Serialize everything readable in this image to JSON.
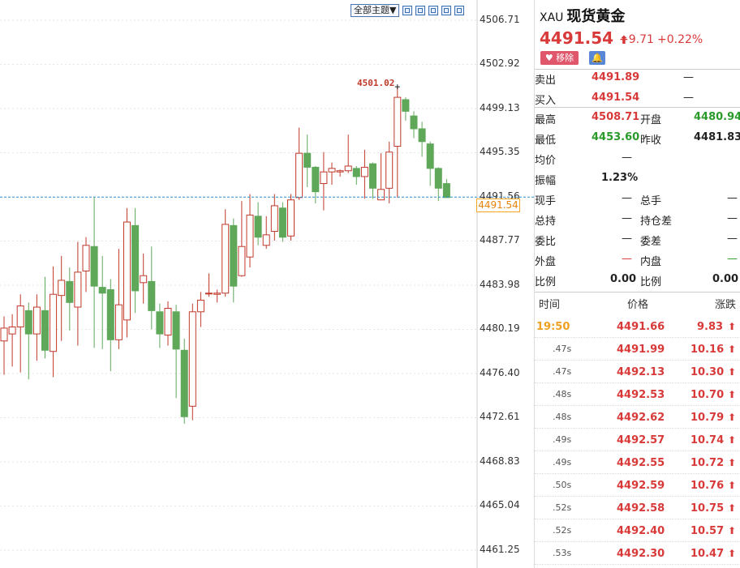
{
  "toolbar": {
    "theme_label": "全部主题▼",
    "icons": [
      "zoom-in-icon",
      "kline-icon",
      "grid-icon",
      "fullscreen-icon",
      "restore-icon"
    ]
  },
  "chart": {
    "max_label": "4501.02",
    "current_price_tag": "4491.54",
    "y_ticks": [
      "4506.71",
      "4502.92",
      "4499.13",
      "4495.35",
      "4491.56",
      "4487.77",
      "4483.98",
      "4480.19",
      "4476.40",
      "4472.61",
      "4468.83",
      "4465.04",
      "4461.25"
    ],
    "colors": {
      "up": "#c0392b",
      "down": "#5fa85a",
      "price_line": "#2f8fd0"
    }
  },
  "chart_data": {
    "type": "candlestick",
    "ylim": [
      4461.25,
      4506.71
    ],
    "current": 4491.54,
    "candles": [
      [
        4479.2,
        4480.3,
        4476.3,
        4481.3
      ],
      [
        4479.8,
        4480.4,
        4477.0,
        4481.5
      ],
      [
        4480.4,
        4482.2,
        4476.5,
        4483.2
      ],
      [
        4481.8,
        4479.8,
        4475.9,
        4482.5
      ],
      [
        4479.8,
        4482.1,
        4477.5,
        4483.2
      ],
      [
        4481.8,
        4478.4,
        4477.7,
        4484.7
      ],
      [
        4478.3,
        4483.2,
        4476.1,
        4485.6
      ],
      [
        4483.1,
        4484.4,
        4479.2,
        4486.5
      ],
      [
        4484.3,
        4482.5,
        4480.1,
        4485.5
      ],
      [
        4482.1,
        4485.1,
        4478.8,
        4487.7
      ],
      [
        4485.2,
        4487.4,
        4483.4,
        4488.1
      ],
      [
        4487.3,
        4483.9,
        4478.6,
        4491.5
      ],
      [
        4483.8,
        4483.3,
        4478.5,
        4486.5
      ],
      [
        4483.6,
        4479.3,
        4476.6,
        4484.5
      ],
      [
        4479.3,
        4482.3,
        4478.5,
        4487.1
      ],
      [
        4481.0,
        4489.4,
        4479.5,
        4490.6
      ],
      [
        4489.1,
        4483.5,
        4481.6,
        4490.6
      ],
      [
        4484.2,
        4484.8,
        4482.4,
        4486.7
      ],
      [
        4484.3,
        4481.8,
        4480.2,
        4487.3
      ],
      [
        4481.7,
        4479.8,
        4478.6,
        4482.4
      ],
      [
        4479.7,
        4482.0,
        4478.8,
        4482.6
      ],
      [
        4481.7,
        4478.5,
        4474.3,
        4482.3
      ],
      [
        4478.4,
        4472.7,
        4472.1,
        4479.4
      ],
      [
        4473.6,
        4481.7,
        4472.4,
        4482.4
      ],
      [
        4481.7,
        4482.7,
        4480.4,
        4483.4
      ],
      [
        4483.3,
        4483.3,
        4483.0,
        4485.0
      ],
      [
        4483.2,
        4483.3,
        4482.5,
        4483.6
      ],
      [
        4483.3,
        4489.2,
        4483.0,
        4490.5
      ],
      [
        4489.1,
        4483.9,
        4482.5,
        4489.7
      ],
      [
        4484.8,
        4487.3,
        4484.7,
        4491.2
      ],
      [
        4486.4,
        4490.0,
        4485.5,
        4491.8
      ],
      [
        4489.9,
        4488.1,
        4487.4,
        4491.1
      ],
      [
        4487.4,
        4488.3,
        4487.1,
        4489.9
      ],
      [
        4488.6,
        4490.8,
        4487.8,
        4491.8
      ],
      [
        4490.6,
        4488.1,
        4487.7,
        4491.1
      ],
      [
        4488.2,
        4491.3,
        4487.8,
        4491.8
      ],
      [
        4491.5,
        4495.3,
        4491.3,
        4497.5
      ],
      [
        4495.3,
        4494.1,
        4492.4,
        4496.9
      ],
      [
        4494.1,
        4492.0,
        4491.0,
        4494.2
      ],
      [
        4492.7,
        4493.7,
        4490.4,
        4495.4
      ],
      [
        4493.7,
        4494.0,
        4492.6,
        4494.5
      ],
      [
        4493.7,
        4493.8,
        4493.3,
        4493.9
      ],
      [
        4493.8,
        4494.2,
        4493.6,
        4496.9
      ],
      [
        4494.0,
        4493.3,
        4492.6,
        4494.2
      ],
      [
        4493.3,
        4494.1,
        4491.4,
        4495.6
      ],
      [
        4494.4,
        4492.3,
        4491.4,
        4494.5
      ],
      [
        4491.3,
        4492.2,
        4491.3,
        4495.3
      ],
      [
        4492.3,
        4495.4,
        4491.0,
        4496.3
      ],
      [
        4495.9,
        4500.1,
        4491.5,
        4501.0
      ],
      [
        4499.9,
        4498.9,
        4498.1,
        4500.1
      ],
      [
        4498.5,
        4497.4,
        4496.6,
        4498.9
      ],
      [
        4497.4,
        4496.3,
        4495.0,
        4498.0
      ],
      [
        4496.1,
        4494.0,
        4492.5,
        4496.3
      ],
      [
        4494.0,
        4492.3,
        4491.2,
        4494.1
      ],
      [
        4492.7,
        4491.5,
        4491.5,
        4493.1
      ]
    ]
  },
  "panel": {
    "code": "XAU",
    "name": "现货黄金",
    "price": "4491.54",
    "change": "+9.71",
    "change_pct": "+0.22%",
    "remove_label": "移除",
    "sell_label": "卖出",
    "sell_value": "4491.89",
    "sell_extra": "—",
    "buy_label": "买入",
    "buy_value": "4491.54",
    "buy_extra": "—",
    "high_label": "最高",
    "high_value": "4508.71",
    "open_label": "开盘",
    "open_value": "4480.94",
    "low_label": "最低",
    "low_value": "4453.60",
    "prev_label": "昨收",
    "prev_value": "4481.83",
    "avg_label": "均价",
    "avg_value": "—",
    "amp_label": "振幅",
    "amp_value": "1.23%",
    "cur_hand_label": "现手",
    "cur_hand_value": "—",
    "total_hand_label": "总手",
    "total_hand_value": "—",
    "total_hold_label": "总持",
    "total_hold_value": "—",
    "hold_diff_label": "持仓差",
    "hold_diff_value": "—",
    "wei_bi_label": "委比",
    "wei_bi_value": "—",
    "wei_cha_label": "委差",
    "wei_cha_value": "—",
    "outer_label": "外盘",
    "outer_value": "—",
    "inner_label": "内盘",
    "inner_value": "—",
    "ratio1_label": "比例",
    "ratio1_value": "0.00",
    "ratio2_label": "比例",
    "ratio2_value": "0.00",
    "tick_headers": [
      "时间",
      "价格",
      "涨跌"
    ],
    "ticks": [
      {
        "time": "19:50",
        "price": "4491.66",
        "chg": "9.83"
      },
      {
        "time": ".47s",
        "price": "4491.99",
        "chg": "10.16"
      },
      {
        "time": ".47s",
        "price": "4492.13",
        "chg": "10.30"
      },
      {
        "time": ".48s",
        "price": "4492.53",
        "chg": "10.70"
      },
      {
        "time": ".48s",
        "price": "4492.62",
        "chg": "10.79"
      },
      {
        "time": ".49s",
        "price": "4492.57",
        "chg": "10.74"
      },
      {
        "time": ".49s",
        "price": "4492.55",
        "chg": "10.72"
      },
      {
        "time": ".50s",
        "price": "4492.59",
        "chg": "10.76"
      },
      {
        "time": ".52s",
        "price": "4492.58",
        "chg": "10.75"
      },
      {
        "time": ".52s",
        "price": "4492.40",
        "chg": "10.57"
      },
      {
        "time": ".53s",
        "price": "4492.30",
        "chg": "10.47"
      }
    ]
  }
}
